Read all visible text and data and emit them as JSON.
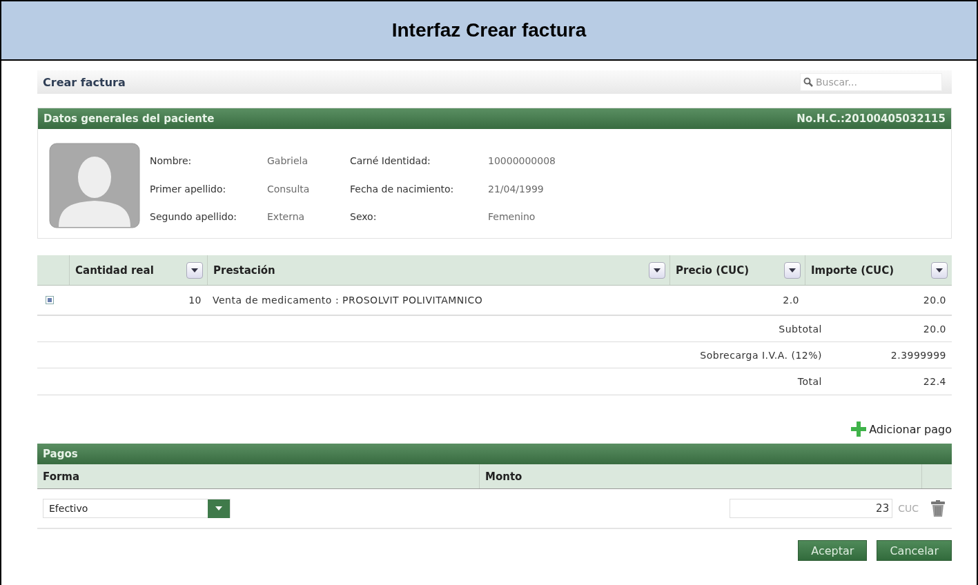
{
  "title": "Interfaz Crear factura",
  "toolbar": {
    "title": "Crear factura",
    "search": {
      "placeholder": "Buscar..."
    }
  },
  "patient": {
    "header": "Datos generales del paciente",
    "record": "No.H.C.:20100405032115",
    "fields": [
      {
        "label": "Nombre:",
        "value": "Gabriela"
      },
      {
        "label": "Carné Identidad:",
        "value": "10000000008"
      },
      {
        "label": "Primer apellido:",
        "value": "Consulta"
      },
      {
        "label": "Fecha de nacimiento:",
        "value": "21/04/1999"
      },
      {
        "label": "Segundo apellido:",
        "value": "Externa"
      },
      {
        "label": "Sexo:",
        "value": "Femenino"
      }
    ]
  },
  "items": {
    "columns": [
      "Cantidad real",
      "Prestación",
      "Precio (CUC)",
      "Importe (CUC)"
    ],
    "rows": [
      {
        "checked": true,
        "quantity": "10",
        "service": "Venta de medicamento : PROSOLVIT POLIVITAMNICO",
        "price": "2.0",
        "amount": "20.0"
      }
    ],
    "summary": [
      {
        "label": "Subtotal",
        "value": "20.0"
      },
      {
        "label": "Sobrecarga I.V.A. (12%)",
        "value": "2.3999999"
      },
      {
        "label": "Total",
        "value": "22.4"
      }
    ]
  },
  "add_payment": "Adicionar pago",
  "payments": {
    "header": "Pagos",
    "columns": [
      "Forma",
      "Monto"
    ],
    "rows": [
      {
        "method": "Efectivo",
        "amount": "23",
        "currency": "CUC"
      }
    ]
  },
  "buttons": [
    "Aceptar",
    "Cancelar"
  ]
}
